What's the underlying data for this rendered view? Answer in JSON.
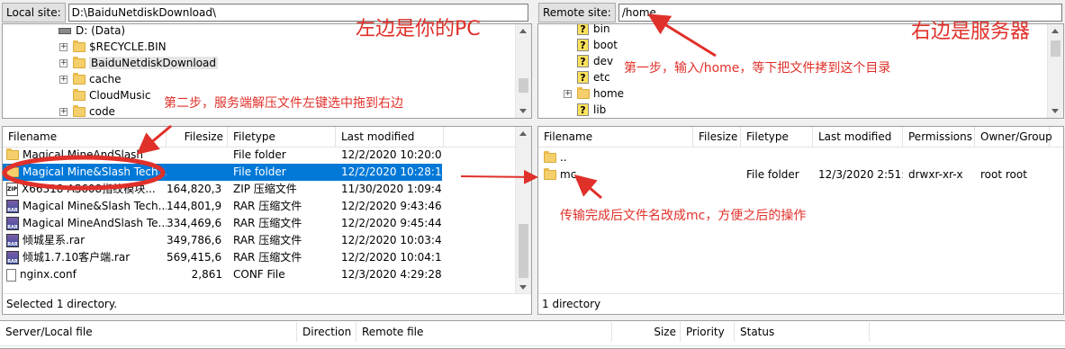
{
  "local": {
    "site_label": "Local site:",
    "path": "D:\\BaiduNetdiskDownload\\",
    "tree": [
      {
        "label": "D: (Data)",
        "icon": "drive-icon",
        "expander": ""
      },
      {
        "label": "$RECYCLE.BIN",
        "icon": "folder-icon",
        "expander": "+"
      },
      {
        "label": "BaiduNetdiskDownload",
        "icon": "folder-icon",
        "expander": "+"
      },
      {
        "label": "cache",
        "icon": "folder-icon",
        "expander": "+"
      },
      {
        "label": "CloudMusic",
        "icon": "folder-icon",
        "expander": ""
      },
      {
        "label": "code",
        "icon": "folder-icon",
        "expander": "+"
      }
    ],
    "columns": [
      "Filename",
      "Filesize",
      "Filetype",
      "Last modified"
    ],
    "files": [
      {
        "name": "Magical MineAndSlash",
        "size": "",
        "type": "File folder",
        "modified": "12/2/2020 10:20:07...",
        "icon": "folder-icon"
      },
      {
        "name": "Magical Mine&Slash Tech...",
        "size": "",
        "type": "File folder",
        "modified": "12/2/2020 10:28:13...",
        "icon": "folder-icon"
      },
      {
        "name": "X66318-AS608指纹模块...",
        "size": "164,820,356",
        "type": "ZIP 压缩文件",
        "modified": "11/30/2020 1:09:45...",
        "icon": "zip-icon"
      },
      {
        "name": "Magical Mine&Slash Tech...",
        "size": "144,801,935",
        "type": "RAR 压缩文件",
        "modified": "12/2/2020 9:43:46 ...",
        "icon": "rar-icon"
      },
      {
        "name": "Magical MineAndSlash Te...",
        "size": "334,469,671",
        "type": "RAR 压缩文件",
        "modified": "12/2/2020 9:45:44 ...",
        "icon": "rar-icon"
      },
      {
        "name": "倾城星系.rar",
        "size": "349,786,657",
        "type": "RAR 压缩文件",
        "modified": "12/2/2020 10:03:48...",
        "icon": "rar-icon"
      },
      {
        "name": "倾城1.7.10客户端.rar",
        "size": "569,415,651",
        "type": "RAR 压缩文件",
        "modified": "12/2/2020 10:04:17...",
        "icon": "rar-icon"
      },
      {
        "name": "nginx.conf",
        "size": "2,861",
        "type": "CONF File",
        "modified": "12/3/2020 4:29:28 ...",
        "icon": "file-icon"
      }
    ],
    "status": "Selected 1 directory."
  },
  "remote": {
    "site_label": "Remote site:",
    "path": "/home",
    "tree": [
      {
        "label": "bin",
        "icon": "unknown-folder-icon",
        "expander": ""
      },
      {
        "label": "boot",
        "icon": "unknown-folder-icon",
        "expander": ""
      },
      {
        "label": "dev",
        "icon": "unknown-folder-icon",
        "expander": ""
      },
      {
        "label": "etc",
        "icon": "unknown-folder-icon",
        "expander": ""
      },
      {
        "label": "home",
        "icon": "folder-icon",
        "expander": "+"
      },
      {
        "label": "lib",
        "icon": "unknown-folder-icon",
        "expander": ""
      }
    ],
    "columns": [
      "Filename",
      "Filesize",
      "Filetype",
      "Last modified",
      "Permissions",
      "Owner/Group"
    ],
    "files": [
      {
        "name": "..",
        "size": "",
        "type": "",
        "modified": "",
        "perms": "",
        "owner": ""
      },
      {
        "name": "mc",
        "size": "",
        "type": "File folder",
        "modified": "12/3/2020 2:51:...",
        "perms": "drwxr-xr-x",
        "owner": "root root"
      }
    ],
    "status": "1 directory"
  },
  "queue": {
    "columns": [
      "Server/Local file",
      "Direction",
      "Remote file",
      "Size",
      "Priority",
      "Status"
    ]
  },
  "annotations": {
    "left_title": "左边是你的PC",
    "right_title": "右边是服务器",
    "step1": "第一步，输入/home，等下把文件拷到这个目录",
    "step2": "第二步，服务端解压文件左键选中拖到右边",
    "step3": "传输完成后文件名改成mc，方便之后的操作"
  },
  "colors": {
    "annotation": "#e0302a",
    "selection": "#0078d7"
  }
}
